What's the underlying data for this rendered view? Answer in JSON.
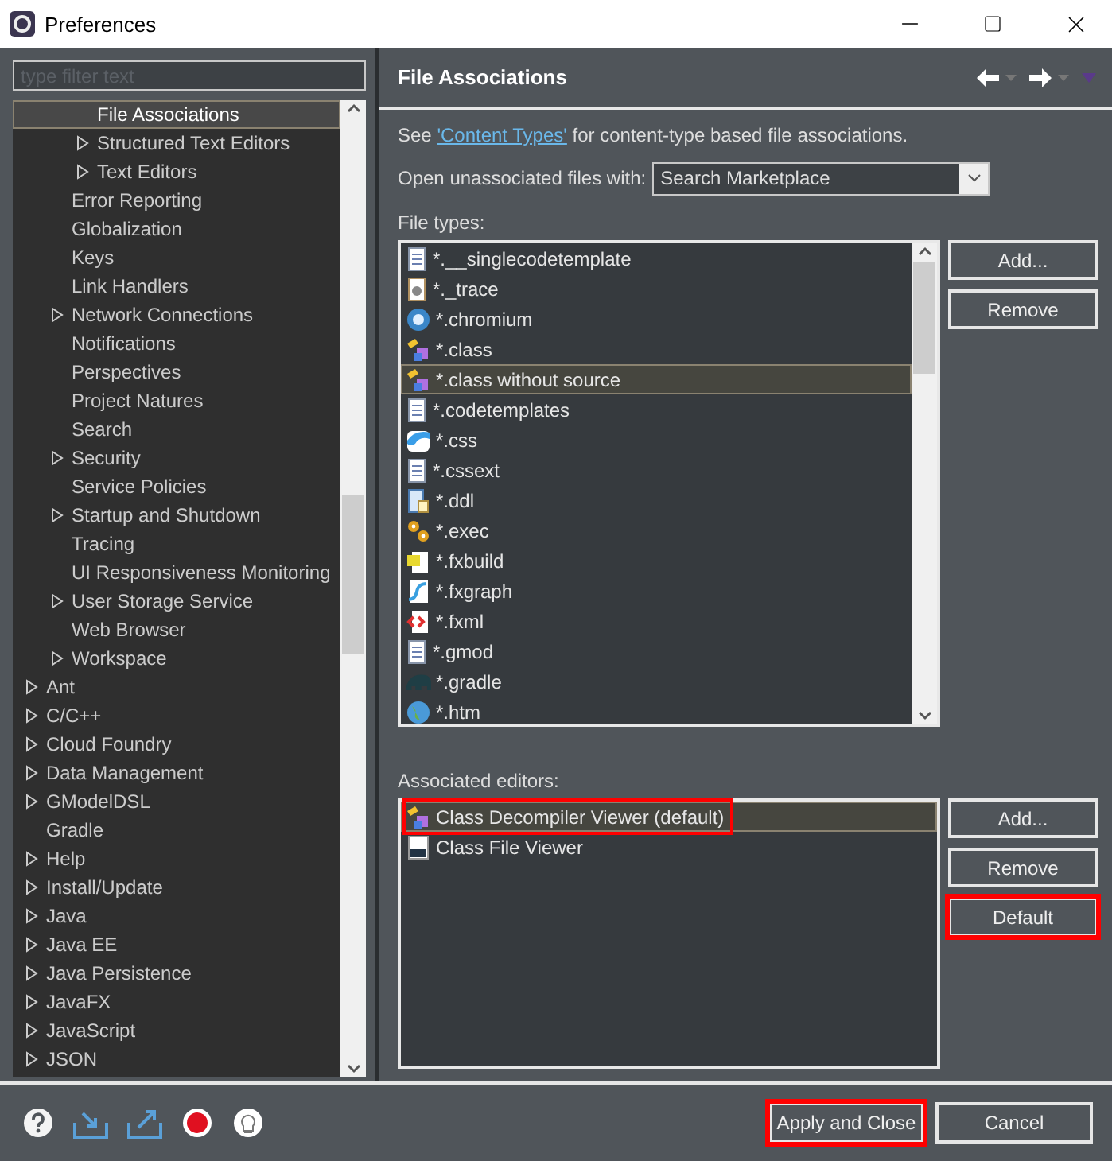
{
  "window": {
    "title": "Preferences"
  },
  "filter": {
    "placeholder": "type filter text"
  },
  "tree": [
    {
      "children": [
        {
          "children": [
            {
              "label": "File Associations",
              "selected": true,
              "expandable": false
            },
            {
              "label": "Structured Text Editors",
              "selected": false,
              "expandable": true
            },
            {
              "label": "Text Editors",
              "selected": false,
              "expandable": true
            }
          ]
        },
        {
          "label": "Error Reporting",
          "selected": false,
          "expandable": false
        },
        {
          "label": "Globalization",
          "selected": false,
          "expandable": false
        },
        {
          "label": "Keys",
          "selected": false,
          "expandable": false
        },
        {
          "label": "Link Handlers",
          "selected": false,
          "expandable": false
        },
        {
          "label": "Network Connections",
          "selected": false,
          "expandable": true
        },
        {
          "label": "Notifications",
          "selected": false,
          "expandable": false
        },
        {
          "label": "Perspectives",
          "selected": false,
          "expandable": false
        },
        {
          "label": "Project Natures",
          "selected": false,
          "expandable": false
        },
        {
          "label": "Search",
          "selected": false,
          "expandable": false
        },
        {
          "label": "Security",
          "selected": false,
          "expandable": true
        },
        {
          "label": "Service Policies",
          "selected": false,
          "expandable": false
        },
        {
          "label": "Startup and Shutdown",
          "selected": false,
          "expandable": true
        },
        {
          "label": "Tracing",
          "selected": false,
          "expandable": false
        },
        {
          "label": "UI Responsiveness Monitoring",
          "selected": false,
          "expandable": false
        },
        {
          "label": "User Storage Service",
          "selected": false,
          "expandable": true
        },
        {
          "label": "Web Browser",
          "selected": false,
          "expandable": false
        },
        {
          "label": "Workspace",
          "selected": false,
          "expandable": true
        }
      ]
    },
    {
      "label": "Ant",
      "selected": false,
      "expandable": true
    },
    {
      "label": "C/C++",
      "selected": false,
      "expandable": true
    },
    {
      "label": "Cloud Foundry",
      "selected": false,
      "expandable": true
    },
    {
      "label": "Data Management",
      "selected": false,
      "expandable": true
    },
    {
      "label": "GModelDSL",
      "selected": false,
      "expandable": true
    },
    {
      "label": "Gradle",
      "selected": false,
      "expandable": false
    },
    {
      "label": "Help",
      "selected": false,
      "expandable": true
    },
    {
      "label": "Install/Update",
      "selected": false,
      "expandable": true
    },
    {
      "label": "Java",
      "selected": false,
      "expandable": true
    },
    {
      "label": "Java EE",
      "selected": false,
      "expandable": true
    },
    {
      "label": "Java Persistence",
      "selected": false,
      "expandable": true
    },
    {
      "label": "JavaFX",
      "selected": false,
      "expandable": true
    },
    {
      "label": "JavaScript",
      "selected": false,
      "expandable": true
    },
    {
      "label": "JSON",
      "selected": false,
      "expandable": true
    }
  ],
  "page": {
    "title": "File Associations",
    "intro": {
      "before": "See ",
      "link": "'Content Types'",
      "after": " for content-type based file associations."
    },
    "open_with": {
      "label": "Open unassociated files with:",
      "value": "Search Marketplace"
    },
    "file_types": {
      "label": "File types:",
      "items": [
        {
          "label": "*.__singlecodetemplate",
          "selected": false
        },
        {
          "label": "*._trace",
          "selected": false
        },
        {
          "label": "*.chromium",
          "selected": false
        },
        {
          "label": "*.class",
          "selected": false
        },
        {
          "label": "*.class without source",
          "selected": true
        },
        {
          "label": "*.codetemplates",
          "selected": false
        },
        {
          "label": "*.css",
          "selected": false
        },
        {
          "label": "*.cssext",
          "selected": false
        },
        {
          "label": "*.ddl",
          "selected": false
        },
        {
          "label": "*.exec",
          "selected": false
        },
        {
          "label": "*.fxbuild",
          "selected": false
        },
        {
          "label": "*.fxgraph",
          "selected": false
        },
        {
          "label": "*.fxml",
          "selected": false
        },
        {
          "label": "*.gmod",
          "selected": false
        },
        {
          "label": "*.gradle",
          "selected": false
        },
        {
          "label": "*.htm",
          "selected": false
        }
      ],
      "buttons": [
        {
          "label": "Add...",
          "highlighted": false
        },
        {
          "label": "Remove",
          "highlighted": false
        }
      ]
    },
    "editors": {
      "label": "Associated editors:",
      "items": [
        {
          "label": "Class Decompiler Viewer (default)",
          "selected": true,
          "highlighted": true
        },
        {
          "label": "Class File Viewer",
          "selected": false,
          "highlighted": false
        }
      ],
      "buttons": [
        {
          "label": "Add...",
          "highlighted": false
        },
        {
          "label": "Remove",
          "highlighted": false
        },
        {
          "label": "Default",
          "highlighted": true
        }
      ]
    }
  },
  "footer": {
    "buttons": [
      {
        "label": "Apply and Close",
        "highlighted": true
      },
      {
        "label": "Cancel",
        "highlighted": false
      }
    ]
  }
}
